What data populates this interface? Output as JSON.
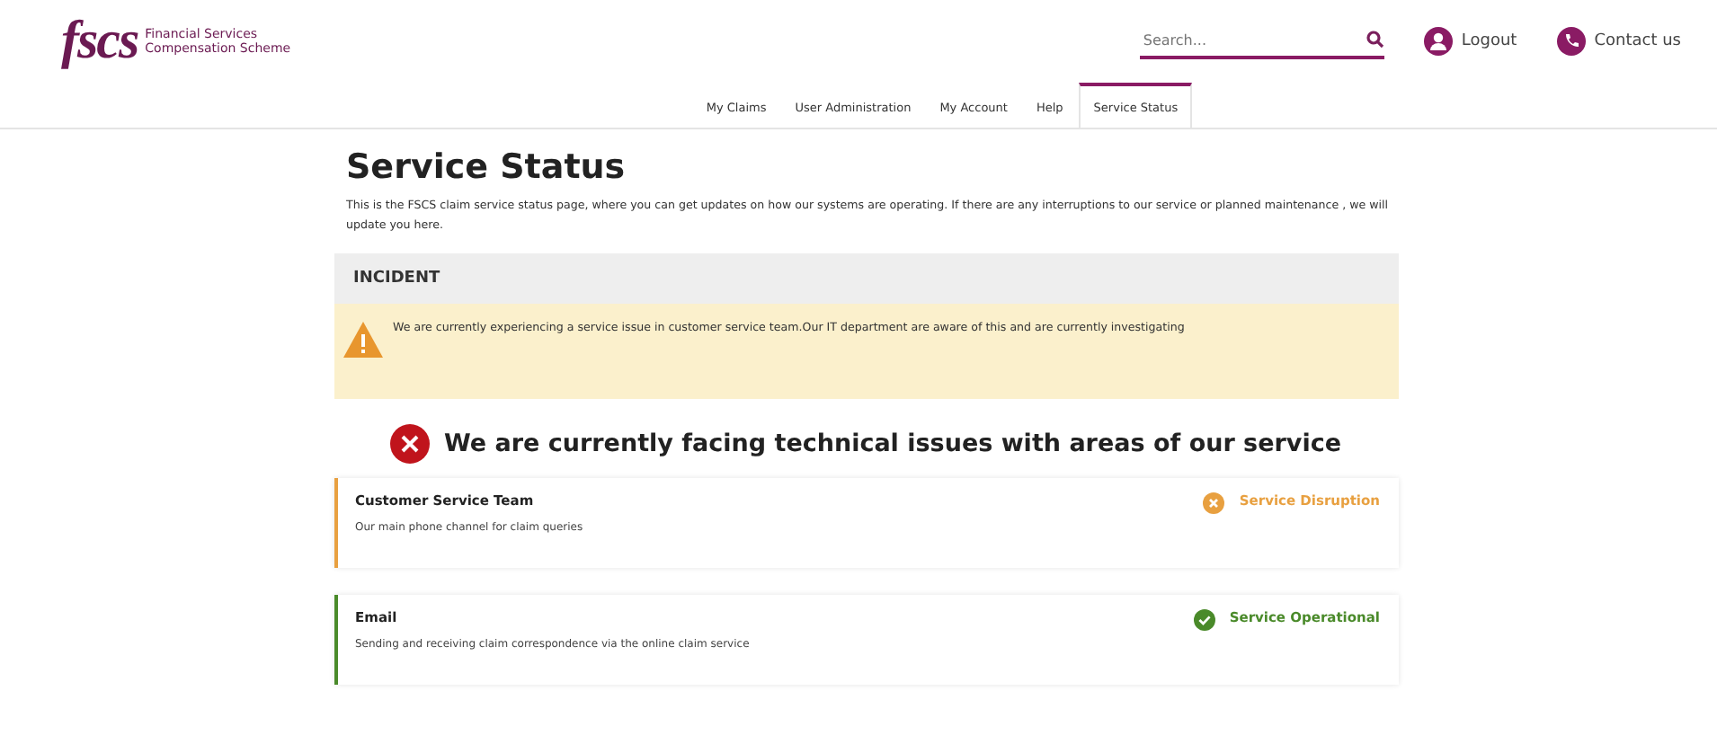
{
  "header": {
    "logo": {
      "mark": "fscs",
      "name_line_1": "Financial Services",
      "name_line_2": "Compensation Scheme"
    },
    "search": {
      "placeholder": "Search..."
    },
    "links": [
      {
        "kind": "logout",
        "label": "Logout"
      },
      {
        "kind": "contact",
        "label": "Contact us"
      }
    ]
  },
  "nav": [
    {
      "label": "My Claims",
      "selected": false
    },
    {
      "label": "User Administration",
      "selected": false
    },
    {
      "label": "My Account",
      "selected": false
    },
    {
      "label": "Help",
      "selected": false
    },
    {
      "label": "Service Status",
      "selected": true
    }
  ],
  "page": {
    "title": "Service Status",
    "intro": "This is the FSCS claim service status page, where you can get updates on how our systems are operating. If there are any interruptions to our service or planned maintenance , we will update you here."
  },
  "incident": {
    "heading": "INCIDENT",
    "message": "We are currently experiencing a service issue in customer service team.Our IT department are aware of this and are currently investigating"
  },
  "summary": {
    "kind": "issues",
    "text": "We are currently facing technical issues with areas of our service"
  },
  "services": [
    {
      "name": "Customer Service Team",
      "description": "Our main phone channel for claim queries",
      "status": "Service Disruption",
      "kind": "disruption",
      "color": "#e8a040"
    },
    {
      "name": "Email",
      "description": "Sending and receiving claim correspondence via the online claim service",
      "status": "Service Operational",
      "kind": "operational",
      "color": "#4a8a2a"
    }
  ]
}
